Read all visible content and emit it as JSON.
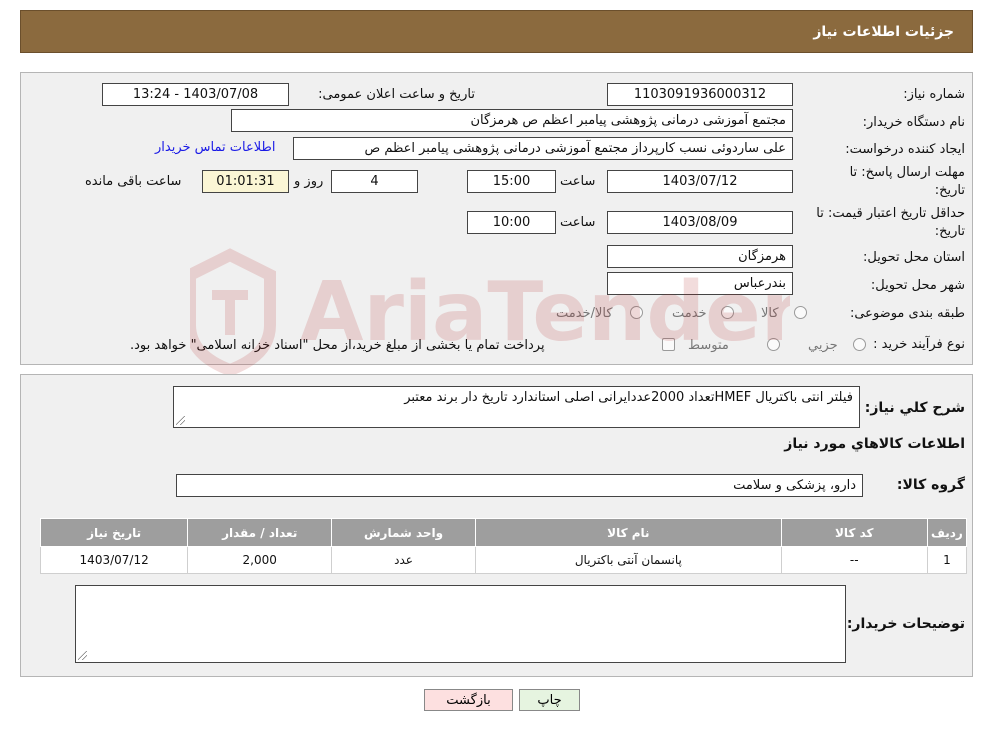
{
  "header": {
    "title": "جزئیات اطلاعات نیاز"
  },
  "form": {
    "need_number_label": "شماره نیاز:",
    "need_number": "1103091936000312",
    "announce_label": "تاریخ و ساعت اعلان عمومی:",
    "announce_value": "1403/07/08 - 13:24",
    "buyer_org_label": "نام دستگاه خریدار:",
    "buyer_org": "مجتمع آموزشی درمانی پژوهشی پیامبر اعظم ص  هرمزگان",
    "creator_label": "ایجاد کننده درخواست:",
    "creator": "علی ساردوئی نسب کارپرداز مجتمع آموزشی درمانی پژوهشی پیامبر اعظم ص",
    "contact_link": "اطلاعات تماس خریدار",
    "deadline_label_1": "مهلت ارسال پاسخ: تا",
    "deadline_label_2": "تاریخ:",
    "deadline_date": "1403/07/12",
    "time_label": "ساعت",
    "deadline_time": "15:00",
    "days": "4",
    "days_label": "روز و",
    "remaining": "01:01:31",
    "remaining_label": "ساعت باقی مانده",
    "validity_label_1": "حداقل تاریخ اعتبار قیمت: تا",
    "validity_label_2": "تاریخ:",
    "validity_date": "1403/08/09",
    "validity_time": "10:00",
    "province_label": "استان محل تحویل:",
    "province": "هرمزگان",
    "city_label": "شهر محل تحویل:",
    "city": "بندرعباس",
    "category_label": "طبقه بندی موضوعی:",
    "category_options": [
      "کالا",
      "خدمت",
      "کالا/خدمت"
    ],
    "process_label": "نوع فرآیند خرید :",
    "process_options": [
      "جزیي",
      "متوسط"
    ],
    "process_note": "پرداخت تمام یا بخشی از مبلغ خرید،از محل \"اسناد خزانه اسلامی\" خواهد بود."
  },
  "details": {
    "summary_label": "شرح کلي نياز:",
    "summary": "فیلتر انتی باکتریال HMEFتعداد 2000عددایرانی اصلی استاندارد تاریخ دار برند معتبر",
    "items_heading": "اطلاعات کالاهاي مورد نياز",
    "group_label": "گروه کالا:",
    "group": "دارو، پزشکی و سلامت",
    "table": {
      "headers": [
        "ردیف",
        "کد کالا",
        "نام کالا",
        "واحد شمارش",
        "تعداد / مقدار",
        "تاریخ نیاز"
      ],
      "rows": [
        [
          "1",
          "--",
          "پانسمان آنتی باکتریال",
          "عدد",
          "2,000",
          "1403/07/12"
        ]
      ]
    },
    "buyer_notes_label": "توضیحات خریدار:"
  },
  "actions": {
    "print": "چاپ",
    "back": "بازگشت"
  },
  "colors": {
    "header": "#8b6a3e",
    "panel": "#f0f0f0",
    "table_header": "#9e9e9e",
    "link": "#1a1ae6",
    "back_button": "#fde0e0",
    "print_button": "#e6f4e0"
  },
  "watermark": {
    "text": "AriaTender.neT"
  }
}
